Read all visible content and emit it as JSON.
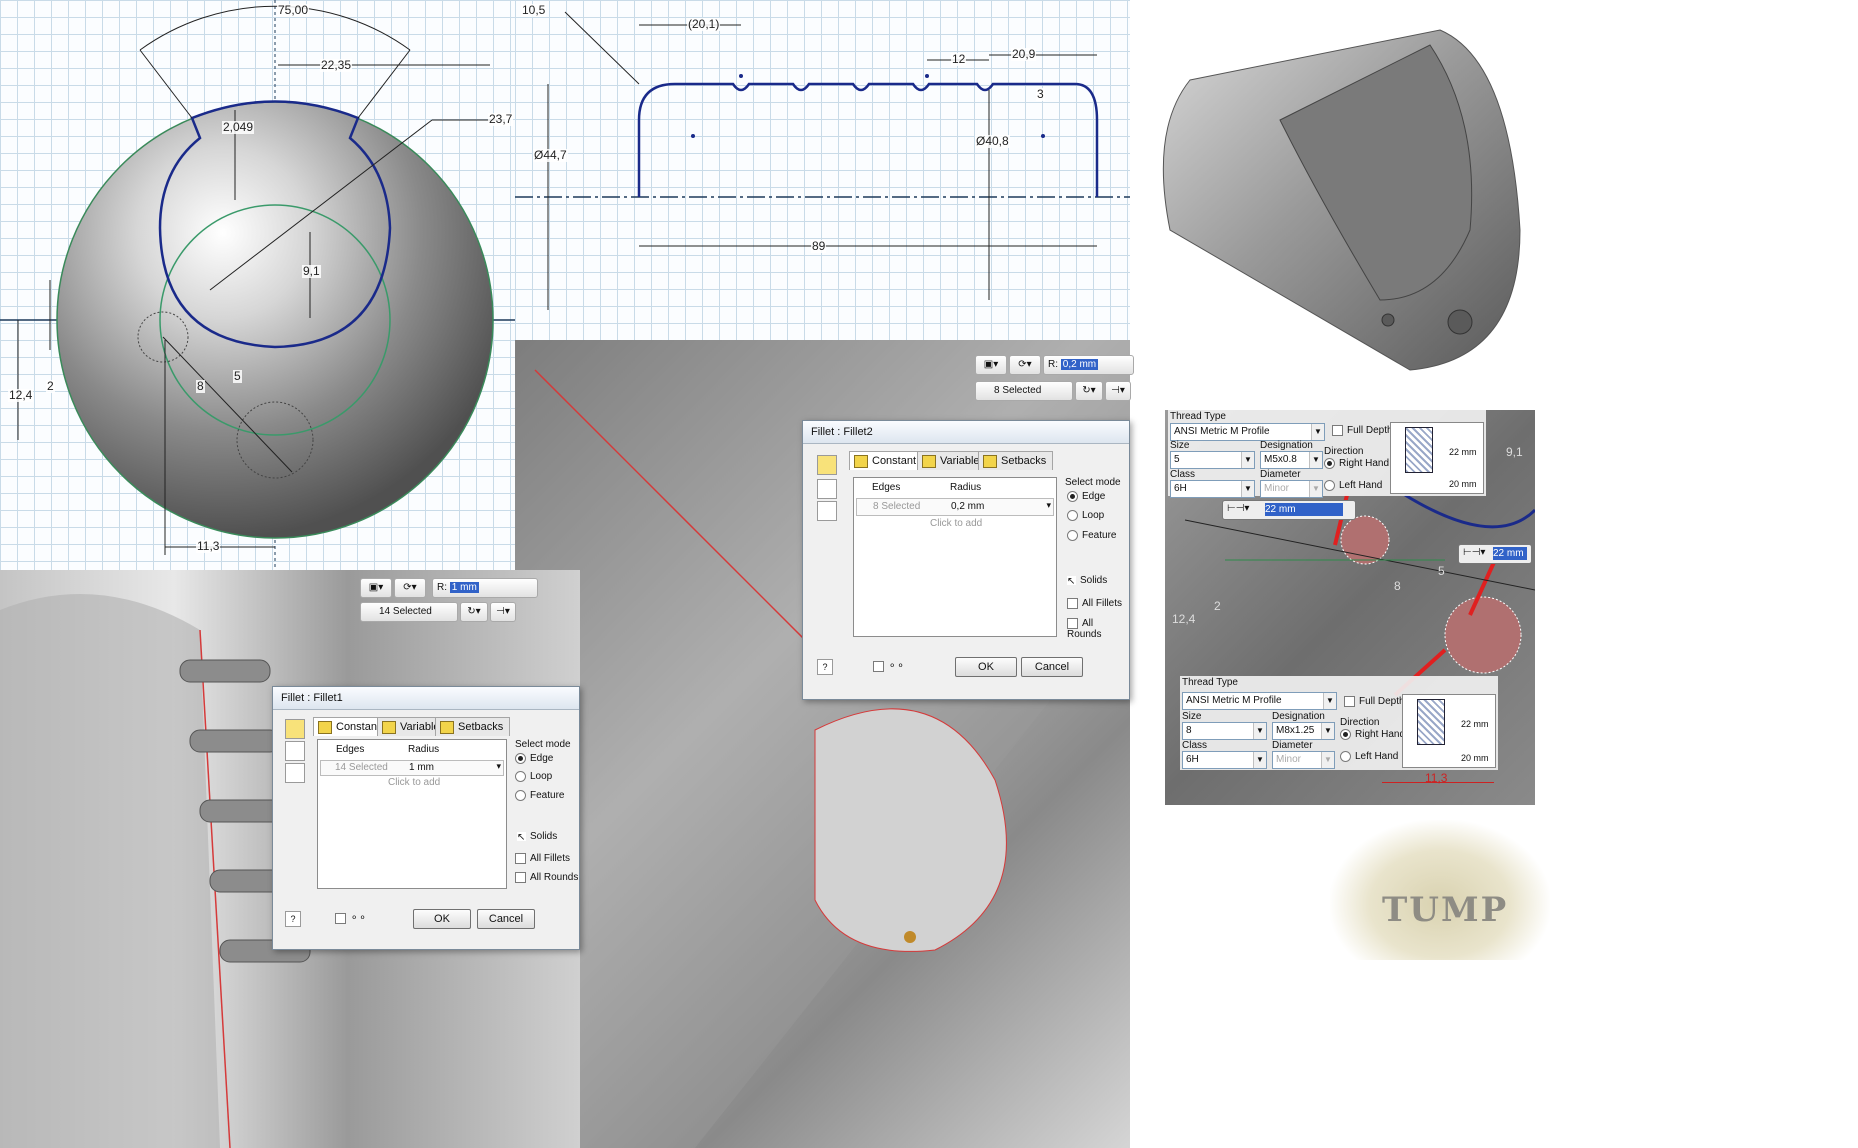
{
  "sketch1": {
    "dims": {
      "angle": "75,00",
      "width": "22,35",
      "diameter": "23,7",
      "slot": "2,049",
      "offset": "9,1",
      "small_h": "2",
      "left_h": "12,4",
      "center": "5",
      "holes": "8",
      "bottom": "11,3"
    }
  },
  "sketch2": {
    "dims": {
      "top_left": "10,5",
      "groove_pos": "(20,1)",
      "spacing": "12",
      "end": "20,9",
      "fillet": "3",
      "outer_dia": "Ø44,7",
      "inner_dia": "Ø40,8",
      "length": "89"
    }
  },
  "mini_toolbar_top": {
    "radius_label": "R:",
    "radius_value": "0,2 mm",
    "selected_text": "8 Selected"
  },
  "mini_toolbar_bottom": {
    "radius_label": "R:",
    "radius_value": "1 mm",
    "selected_text": "14 Selected"
  },
  "fillet2": {
    "title": "Fillet : Fillet2",
    "tabs": [
      "Constant",
      "Variable",
      "Setbacks"
    ],
    "col_edges": "Edges",
    "col_radius": "Radius",
    "row_edges": "8 Selected",
    "row_radius": "0,2 mm",
    "click_to_add": "Click to add",
    "select_mode": "Select mode",
    "modes": [
      "Edge",
      "Loop",
      "Feature"
    ],
    "solids": "Solids",
    "all_fillets": "All Fillets",
    "all_rounds": "All Rounds",
    "ok": "OK",
    "cancel": "Cancel"
  },
  "fillet1": {
    "title": "Fillet : Fillet1",
    "tabs": [
      "Constant",
      "Variable",
      "Setbacks"
    ],
    "col_edges": "Edges",
    "col_radius": "Radius",
    "row_edges": "14 Selected",
    "row_radius": "1 mm",
    "click_to_add": "Click to add",
    "select_mode": "Select mode",
    "modes": [
      "Edge",
      "Loop",
      "Feature"
    ],
    "solids": "Solids",
    "all_fillets": "All Fillets",
    "all_rounds": "All Rounds",
    "ok": "OK",
    "cancel": "Cancel"
  },
  "thread1": {
    "thread_type_label": "Thread Type",
    "thread_type": "ANSI Metric M Profile",
    "full_depth": "Full Depth",
    "size_label": "Size",
    "size": "5",
    "designation_label": "Designation",
    "designation": "M5x0.8",
    "class_label": "Class",
    "class": "6H",
    "diameter_label": "Diameter",
    "diameter": "Minor",
    "direction_label": "Direction",
    "right_hand": "Right Hand",
    "left_hand": "Left Hand",
    "depth1": "22 mm",
    "depth2": "20 mm",
    "input_value": "22 mm"
  },
  "thread2": {
    "thread_type_label": "Thread Type",
    "thread_type": "ANSI Metric M Profile",
    "full_depth": "Full Depth",
    "size_label": "Size",
    "size": "8",
    "designation_label": "Designation",
    "designation": "M8x1.25",
    "class_label": "Class",
    "class": "6H",
    "diameter_label": "Diameter",
    "diameter": "Minor",
    "direction_label": "Direction",
    "right_hand": "Right Hand",
    "left_hand": "Left Hand",
    "depth1": "22 mm",
    "depth2": "20 mm",
    "input_value": "22 mm",
    "bottom_dim": "11,3"
  },
  "thread_view_dims": {
    "left": "12,4",
    "two": "2",
    "five": "5",
    "eight": "8",
    "nine": "9,1"
  },
  "watermark": "TUMP"
}
